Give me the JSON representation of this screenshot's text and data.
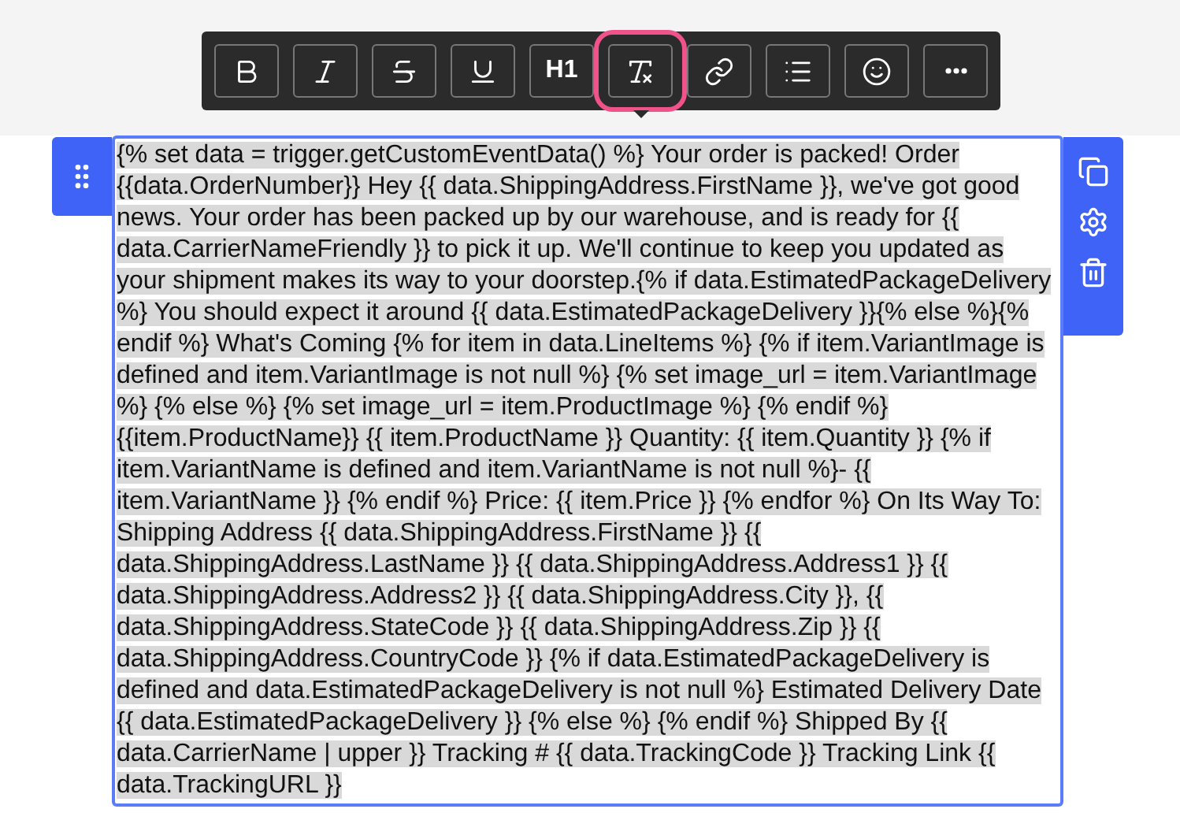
{
  "toolbar": {
    "buttons": [
      {
        "kind": "bold",
        "selected": false
      },
      {
        "kind": "italic",
        "selected": false
      },
      {
        "kind": "strikethrough",
        "selected": false
      },
      {
        "kind": "underline",
        "selected": false
      },
      {
        "kind": "heading",
        "label": "H1",
        "selected": false
      },
      {
        "kind": "clear-format",
        "selected": true
      },
      {
        "kind": "link",
        "selected": false
      },
      {
        "kind": "list",
        "selected": false
      },
      {
        "kind": "emoji",
        "selected": false
      },
      {
        "kind": "more",
        "selected": false
      }
    ]
  },
  "block": {
    "selected_text": "{% set data = trigger.getCustomEventData() %} Your order is packed! Order {{data.OrderNumber}} Hey {{ data.ShippingAddress.FirstName }}, we've got good news. Your order has been packed up by our warehouse, and is ready for {{ data.CarrierNameFriendly }} to pick it up. We'll continue to keep you updated as your shipment makes its way to your doorstep.{% if data.EstimatedPackageDelivery %} You should expect it around {{ data.EstimatedPackageDelivery }}{% else %}{% endif %} What's Coming {% for item in data.LineItems %} {% if item.VariantImage is defined and item.VariantImage is not null %} {% set image_url = item.VariantImage %} {% else %} {% set image_url = item.ProductImage %} {% endif %} {{item.ProductName}} {{ item.ProductName }} Quantity: {{ item.Quantity }} {% if item.VariantName is defined and item.VariantName is not null %}- {{ item.VariantName }} {% endif %} Price: {{ item.Price }} {% endfor %} On Its Way To: Shipping Address {{ data.ShippingAddress.FirstName }} {{ data.ShippingAddress.LastName }} {{ data.ShippingAddress.Address1 }} {{ data.ShippingAddress.Address2 }} {{ data.ShippingAddress.City }}, {{ data.ShippingAddress.StateCode }} {{ data.ShippingAddress.Zip }} {{ data.ShippingAddress.CountryCode }} {% if data.EstimatedPackageDelivery is defined and data.EstimatedPackageDelivery is not null %} Estimated Delivery Date {{ data.EstimatedPackageDelivery }} {% else %} {% endif %} Shipped By {{ data.CarrierName | upper }} Tracking # {{ data.TrackingCode }} Tracking Link {{ data.TrackingURL }}"
  }
}
